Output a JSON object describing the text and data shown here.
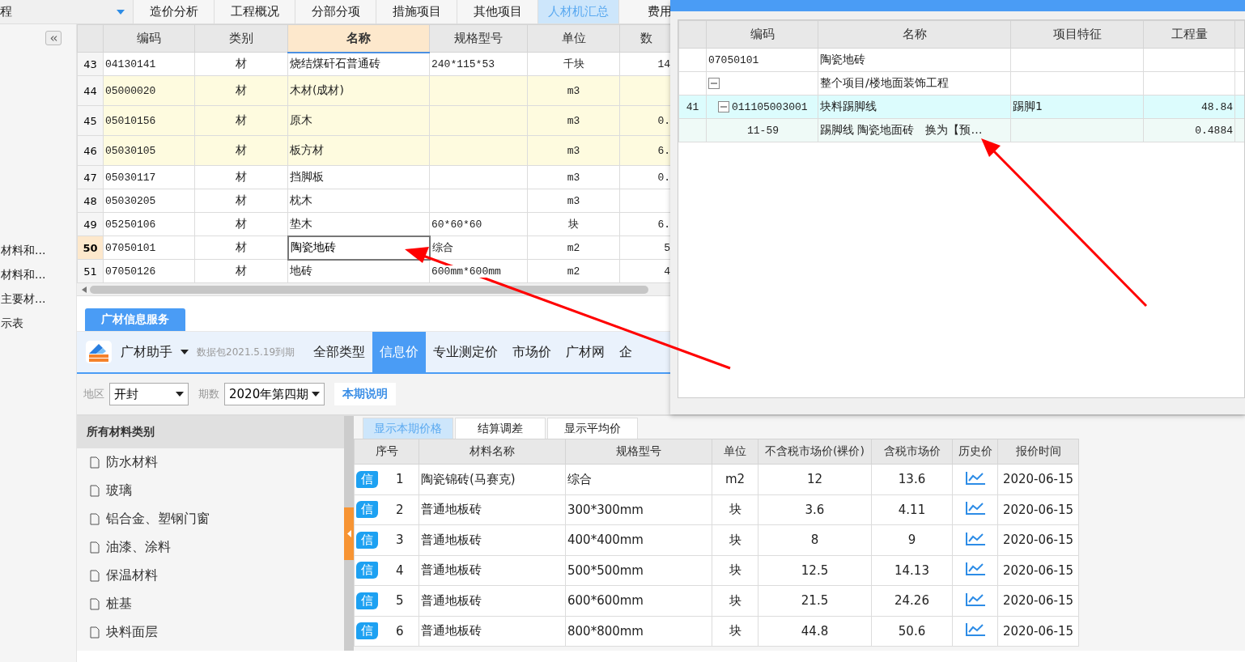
{
  "top_bar": {
    "project": "程",
    "tabs": [
      {
        "label": "造价分析",
        "selected": false
      },
      {
        "label": "工程概况",
        "selected": false
      },
      {
        "label": "分部分项",
        "selected": false
      },
      {
        "label": "措施项目",
        "selected": false
      },
      {
        "label": "其他项目",
        "selected": false
      },
      {
        "label": "人材机汇总",
        "selected": true
      },
      {
        "label": "费用",
        "selected": false
      }
    ]
  },
  "sidebar": {
    "items": [
      "材料和...",
      "材料和...",
      "主要材...",
      "示表"
    ]
  },
  "materials_table": {
    "columns": [
      "编码",
      "类别",
      "名称",
      "规格型号",
      "单位",
      "数"
    ],
    "rows": [
      {
        "index": "43",
        "code": "04130141",
        "type": "材",
        "name": "烧结煤矸石普通砖",
        "spec": "240*115*53",
        "unit": "千块",
        "quantity": "14",
        "highlighted": false,
        "selected": false
      },
      {
        "index": "44",
        "code": "05000020",
        "type": "材",
        "name": "木材(成材)",
        "unit": "m3",
        "highlighted": true,
        "selected": false
      },
      {
        "index": "45",
        "code": "05010156",
        "type": "材",
        "name": "原木",
        "unit": "m3",
        "quantity": "0.",
        "highlighted": true,
        "selected": false
      },
      {
        "index": "46",
        "code": "05030105",
        "type": "材",
        "name": "板方材",
        "unit": "m3",
        "quantity": "6.",
        "highlighted": true,
        "selected": false
      },
      {
        "index": "47",
        "code": "05030117",
        "type": "材",
        "name": "挡脚板",
        "unit": "m3",
        "quantity": "0.",
        "highlighted": false,
        "selected": false
      },
      {
        "index": "48",
        "code": "05030205",
        "type": "材",
        "name": "枕木",
        "unit": "m3",
        "highlighted": false,
        "selected": false
      },
      {
        "index": "49",
        "code": "05250106",
        "type": "材",
        "name": "垫木",
        "spec": "60*60*60",
        "unit": "块",
        "quantity": "6.",
        "highlighted": false,
        "selected": false
      },
      {
        "index": "50",
        "code": "07050101",
        "type": "材",
        "name": "陶瓷地砖",
        "spec": "综合",
        "unit": "m2",
        "quantity": "5",
        "highlighted": false,
        "selected": true
      },
      {
        "index": "51",
        "code": "07050126",
        "type": "材",
        "name": "地砖",
        "spec": "600mm*600mm",
        "unit": "m2",
        "quantity": "4",
        "highlighted": false,
        "selected": false
      }
    ]
  },
  "service_tab": "广材信息服务",
  "assistant": {
    "name": "广材助手",
    "package": "数据包2021.5.19到期",
    "tabs": [
      {
        "label": "全部类型",
        "selected": false
      },
      {
        "label": "信息价",
        "selected": true
      },
      {
        "label": "专业测定价",
        "selected": false
      },
      {
        "label": "市场价",
        "selected": false
      },
      {
        "label": "广材网",
        "selected": false
      },
      {
        "label": "企",
        "selected": false
      }
    ]
  },
  "filters": {
    "region_label": "地区",
    "region": "开封",
    "period_label": "期数",
    "period": "2020年第四期",
    "notes_button": "本期说明"
  },
  "categories": {
    "title": "所有材料类别",
    "items": [
      "防水材料",
      "玻璃",
      "铝合金、塑钢门窗",
      "油漆、涂料",
      "保温材料",
      "桩基",
      "块料面层"
    ]
  },
  "price_view_tabs": [
    {
      "label": "显示本期价格",
      "selected": true
    },
    {
      "label": "结算调差",
      "selected": false
    },
    {
      "label": "显示平均价",
      "selected": false
    }
  ],
  "price_table": {
    "columns": [
      "序号",
      "材料名称",
      "规格型号",
      "单位",
      "不含税市场价(裸价)",
      "含税市场价",
      "历史价",
      "报价时间"
    ],
    "rows": [
      {
        "badge": "信",
        "index": "1",
        "name": "陶瓷锦砖(马赛克)",
        "spec": "综合",
        "unit": "m2",
        "price_ex_tax": "12",
        "price_tax": "13.6",
        "date": "2020-06-15"
      },
      {
        "badge": "信",
        "index": "2",
        "name": "普通地板砖",
        "spec": "300*300mm",
        "unit": "块",
        "price_ex_tax": "3.6",
        "price_tax": "4.11",
        "date": "2020-06-15"
      },
      {
        "badge": "信",
        "index": "3",
        "name": "普通地板砖",
        "spec": "400*400mm",
        "unit": "块",
        "price_ex_tax": "8",
        "price_tax": "9",
        "date": "2020-06-15"
      },
      {
        "badge": "信",
        "index": "4",
        "name": "普通地板砖",
        "spec": "500*500mm",
        "unit": "块",
        "price_ex_tax": "12.5",
        "price_tax": "14.13",
        "date": "2020-06-15"
      },
      {
        "badge": "信",
        "index": "5",
        "name": "普通地板砖",
        "spec": "600*600mm",
        "unit": "块",
        "price_ex_tax": "21.5",
        "price_tax": "24.26",
        "date": "2020-06-15"
      },
      {
        "badge": "信",
        "index": "6",
        "name": "普通地板砖",
        "spec": "800*800mm",
        "unit": "块",
        "price_ex_tax": "44.8",
        "price_tax": "50.6",
        "date": "2020-06-15"
      }
    ]
  },
  "popup": {
    "columns": [
      "编码",
      "名称",
      "项目特征",
      "工程量"
    ],
    "rows": [
      {
        "code": "07050101",
        "name": "陶瓷地砖"
      },
      {
        "name": "整个项目/楼地面装饰工程",
        "expanded": true,
        "children": [
          {
            "index": "41",
            "code": "011105003001",
            "name": "块料踢脚线",
            "feature": "踢脚1",
            "quantity": "48.84",
            "expanded": true,
            "children": [
              {
                "code": "11-59",
                "name": "踢脚线 陶瓷地面砖　换为【预…",
                "quantity": "0.4884"
              }
            ]
          }
        ]
      }
    ]
  }
}
